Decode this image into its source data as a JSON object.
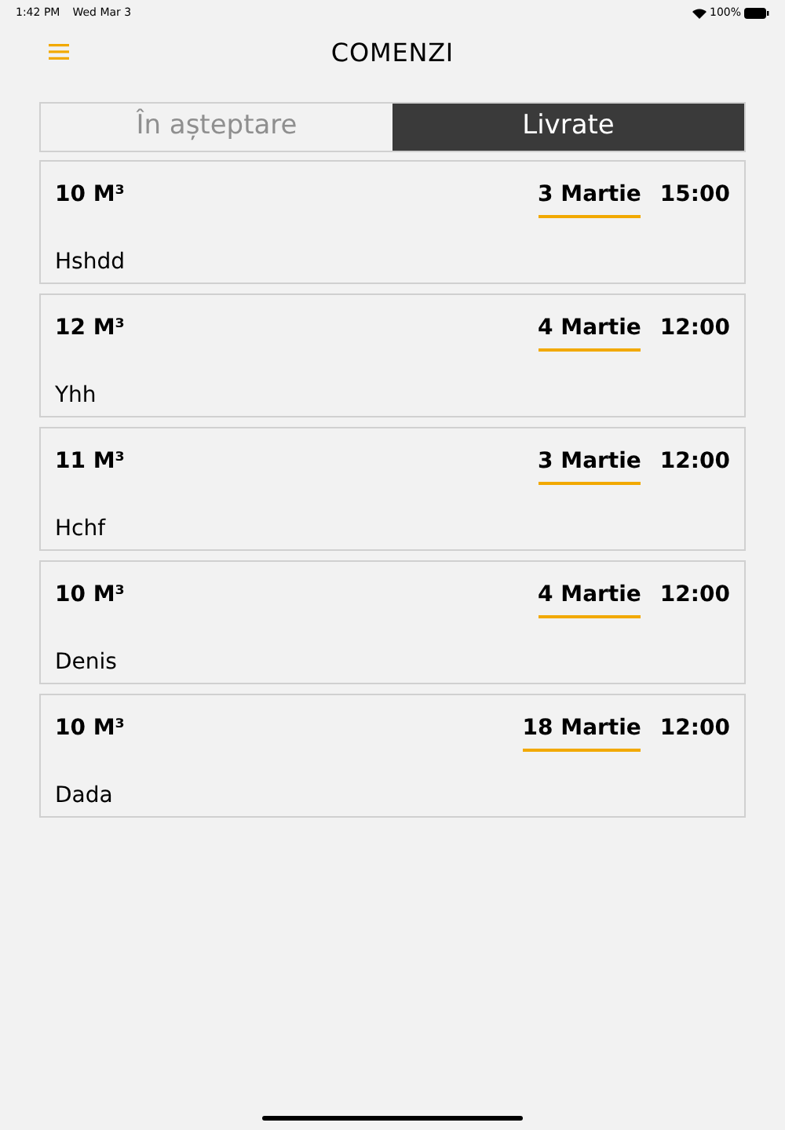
{
  "status_bar": {
    "time": "1:42 PM",
    "date": "Wed Mar 3",
    "battery": "100%"
  },
  "header": {
    "title": "COMENZI"
  },
  "tabs": [
    {
      "label": "În așteptare",
      "selected": false
    },
    {
      "label": "Livrate",
      "selected": true
    }
  ],
  "orders": [
    {
      "volume": "10 M³",
      "date": "3 Martie",
      "time": "15:00",
      "name": "Hshdd"
    },
    {
      "volume": "12 M³",
      "date": "4 Martie",
      "time": "12:00",
      "name": "Yhh"
    },
    {
      "volume": "11 M³",
      "date": "3 Martie",
      "time": "12:00",
      "name": "Hchf"
    },
    {
      "volume": "10 M³",
      "date": "4 Martie",
      "time": "12:00",
      "name": "Denis"
    },
    {
      "volume": "10 M³",
      "date": "18 Martie",
      "time": "12:00",
      "name": "Dada"
    }
  ]
}
